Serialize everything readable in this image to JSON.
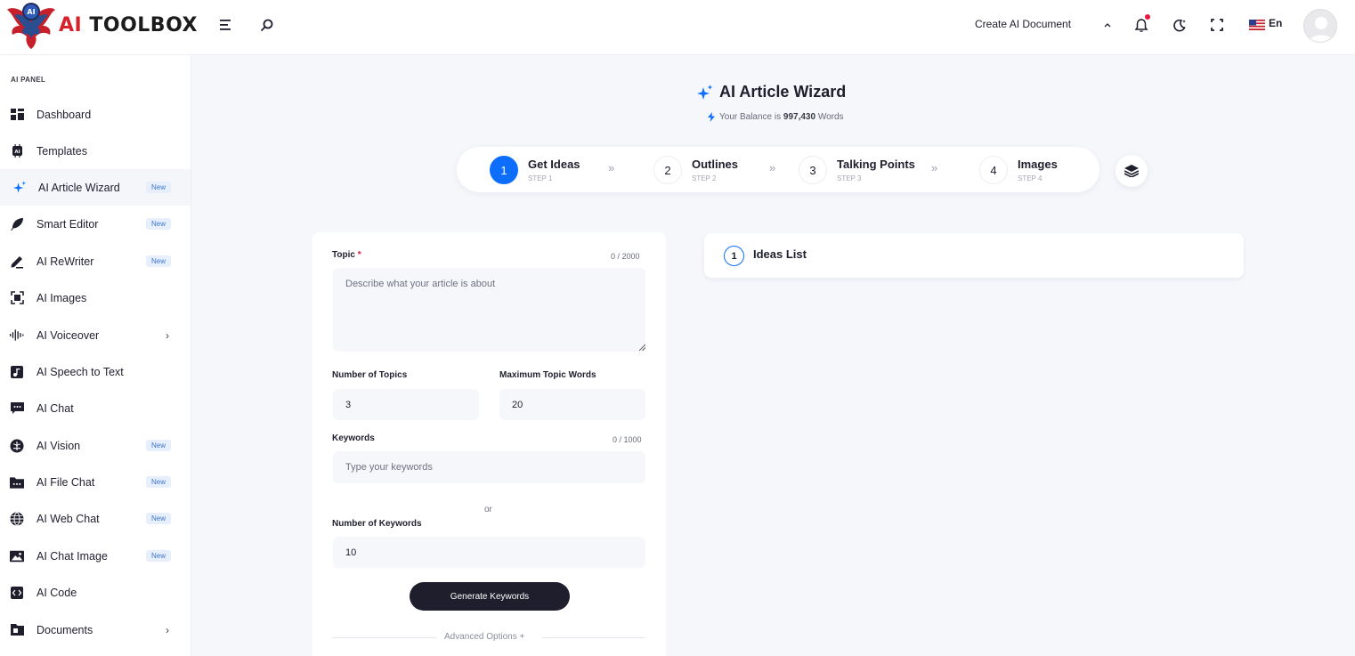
{
  "header": {
    "logo_ai": "AI",
    "logo_rest": " TOOLBOX",
    "emblem_text": "AI",
    "create_doc_label": "Create AI Document",
    "language": "En"
  },
  "sidebar": {
    "panel_title": "AI PANEL",
    "items": [
      {
        "label": "Dashboard",
        "icon": "dashboard-icon"
      },
      {
        "label": "Templates",
        "icon": "ai-chip-icon"
      },
      {
        "label": "AI Article Wizard",
        "icon": "sparkle-icon",
        "badge": "New",
        "active": true
      },
      {
        "label": "Smart Editor",
        "icon": "feather-icon",
        "badge": "New"
      },
      {
        "label": "AI ReWriter",
        "icon": "pen-icon",
        "badge": "New"
      },
      {
        "label": "AI Images",
        "icon": "image-scan-icon"
      },
      {
        "label": "AI Voiceover",
        "icon": "waveform-icon",
        "chevron": true
      },
      {
        "label": "AI Speech to Text",
        "icon": "audio-file-icon"
      },
      {
        "label": "AI Chat",
        "icon": "chat-icon"
      },
      {
        "label": "AI Vision",
        "icon": "brain-icon",
        "badge": "New"
      },
      {
        "label": "AI File Chat",
        "icon": "folder-chat-icon",
        "badge": "New"
      },
      {
        "label": "AI Web Chat",
        "icon": "globe-icon",
        "badge": "New"
      },
      {
        "label": "AI Chat Image",
        "icon": "picture-icon",
        "badge": "New"
      },
      {
        "label": "AI Code",
        "icon": "code-icon"
      },
      {
        "label": "Documents",
        "icon": "folder-icon",
        "chevron": true
      }
    ]
  },
  "wizard": {
    "title": "AI Article Wizard",
    "balance_prefix": "Your Balance is",
    "balance_value": "997,430",
    "balance_suffix": "Words",
    "steps": [
      {
        "num": "1",
        "title": "Get Ideas",
        "sub": "STEP 1",
        "active": true
      },
      {
        "num": "2",
        "title": "Outlines",
        "sub": "STEP 2"
      },
      {
        "num": "3",
        "title": "Talking Points",
        "sub": "STEP 3"
      },
      {
        "num": "4",
        "title": "Images",
        "sub": "STEP 4"
      }
    ],
    "arrow": "»"
  },
  "form": {
    "topic_label": "Topic",
    "required_mark": "*",
    "topic_count": "0 / 2000",
    "topic_placeholder": "Describe what your article is about",
    "num_topics_label": "Number of Topics",
    "num_topics_value": "3",
    "max_words_label": "Maximum Topic Words",
    "max_words_value": "20",
    "keywords_label": "Keywords",
    "keywords_count": "0 / 1000",
    "keywords_placeholder": "Type your keywords",
    "or_text": "or",
    "num_keywords_label": "Number of Keywords",
    "num_keywords_value": "10",
    "generate_button": "Generate Keywords",
    "advanced_options": "Advanced Options +"
  },
  "ideas": {
    "num": "1",
    "title": "Ideas List"
  },
  "colors": {
    "accent": "#0d6efd",
    "dark": "#1e1e2d",
    "badge_bg": "#e6effb",
    "badge_text": "#3f76c9",
    "logo_red": "#d8222b"
  }
}
